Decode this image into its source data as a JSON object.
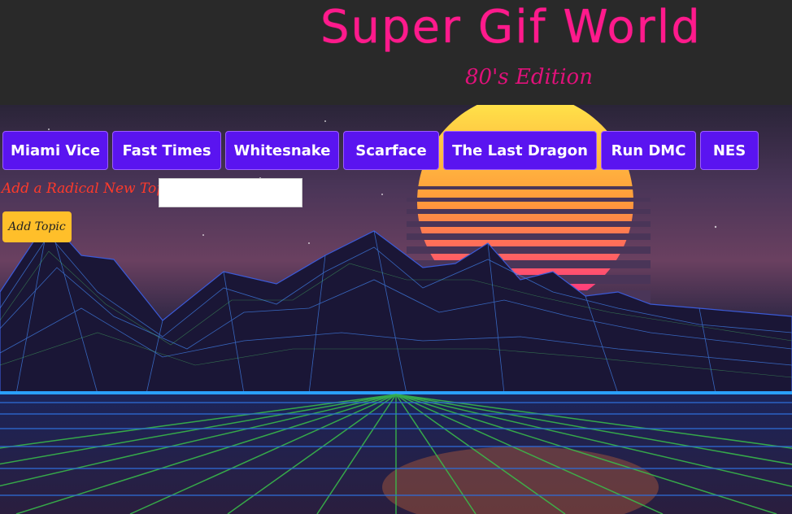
{
  "header": {
    "title": "Super Gif World",
    "subtitle": "80's Edition"
  },
  "topics": [
    {
      "label": "Miami Vice"
    },
    {
      "label": "Fast Times"
    },
    {
      "label": "Whitesnake"
    },
    {
      "label": "Scarface"
    },
    {
      "label": "The Last Dragon"
    },
    {
      "label": "Run DMC"
    },
    {
      "label": "NES"
    }
  ],
  "form": {
    "label": "Add a Radical New Topic",
    "input_value": "",
    "submit_label": "Add Topic"
  },
  "colors": {
    "title": "#ff1a8c",
    "topic_button": "#5a14f0",
    "add_button": "#ffbf2a",
    "label": "#ff3a2a"
  }
}
